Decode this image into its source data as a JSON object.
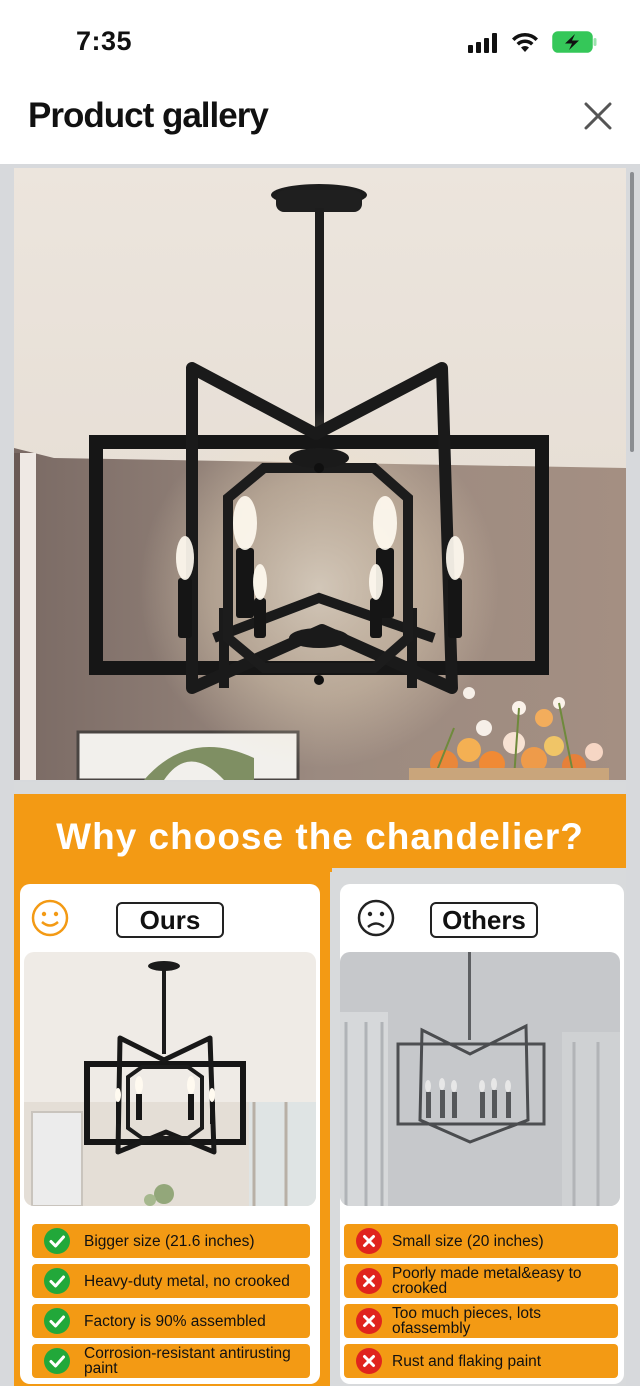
{
  "status_bar": {
    "time": "7:35"
  },
  "header": {
    "title": "Product gallery"
  },
  "infographic": {
    "headline": "Why choose the chandelier?",
    "ours": {
      "label": "Ours",
      "features": [
        "Bigger size (21.6 inches)",
        "Heavy-duty metal, no crooked",
        "Factory is 90% assembled",
        "Corrosion-resistant antirusting paint"
      ]
    },
    "others": {
      "label": "Others",
      "features": [
        "Small size (20 inches)",
        "Poorly made metal&easy to crooked",
        "Too much pieces, lots ofassembly",
        "Rust and flaking paint"
      ]
    }
  },
  "colors": {
    "accent_orange": "#f39a14",
    "check_green": "#22a83a",
    "cross_red": "#e0241d",
    "battery_green": "#35c759"
  },
  "icons": {
    "close": "close-icon",
    "signal": "cellular-signal-icon",
    "wifi": "wifi-icon",
    "battery": "battery-charging-icon",
    "happy": "smiley-face-icon",
    "sad": "sad-face-icon",
    "check": "check-icon",
    "cross": "cross-icon"
  }
}
